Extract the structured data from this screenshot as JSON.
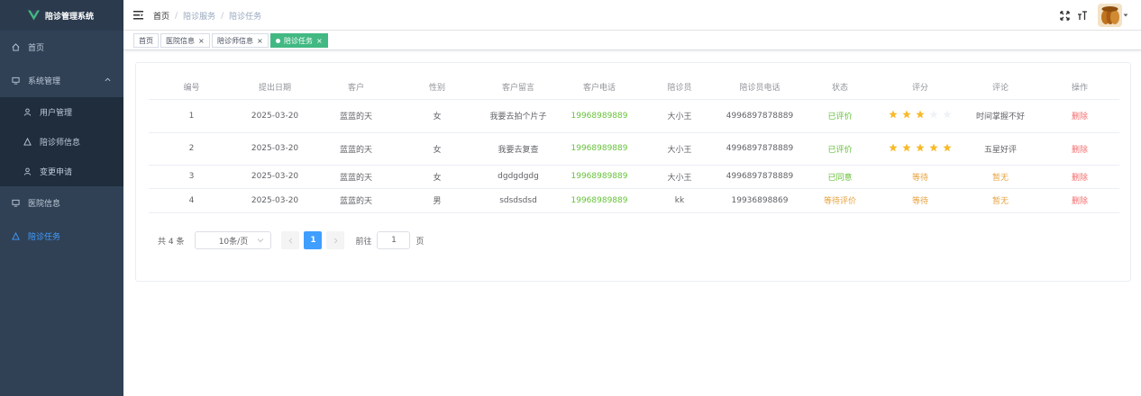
{
  "app": {
    "title": "陪诊管理系统",
    "brand_color": "#42b983"
  },
  "sidebar": {
    "items": [
      {
        "label": "首页",
        "icon": "home-icon"
      },
      {
        "label": "系统管理",
        "icon": "monitor-icon",
        "expanded": true,
        "children": [
          {
            "label": "用户管理",
            "icon": "user-icon"
          },
          {
            "label": "陪诊师信息",
            "icon": "peoples-icon"
          },
          {
            "label": "变更申请",
            "icon": "user-icon"
          }
        ]
      },
      {
        "label": "医院信息",
        "icon": "monitor-icon"
      },
      {
        "label": "陪诊任务",
        "icon": "peoples-icon",
        "active": true
      }
    ]
  },
  "navbar": {
    "breadcrumb": [
      "首页",
      "陪诊服务",
      "陪诊任务"
    ]
  },
  "tags": [
    {
      "label": "首页",
      "closable": false
    },
    {
      "label": "医院信息",
      "closable": true
    },
    {
      "label": "陪诊师信息",
      "closable": true
    },
    {
      "label": "陪诊任务",
      "closable": true,
      "active": true
    }
  ],
  "table": {
    "columns": [
      "编号",
      "提出日期",
      "客户",
      "性别",
      "客户留言",
      "客户电话",
      "陪诊员",
      "陪诊员电话",
      "状态",
      "评分",
      "评论",
      "操作"
    ],
    "rows": [
      {
        "id": "1",
        "date": "2025-03-20",
        "customer": "蓝蓝的天",
        "gender": "女",
        "message": "我要去拍个片子",
        "phone": "19968989889",
        "escort": "大小王",
        "escort_phone": "4996897878889",
        "status": "已评价",
        "rating": 3,
        "comment": "时间掌握不好",
        "action": "删除"
      },
      {
        "id": "2",
        "date": "2025-03-20",
        "customer": "蓝蓝的天",
        "gender": "女",
        "message": "我要去复查",
        "phone": "19968989889",
        "escort": "大小王",
        "escort_phone": "4996897878889",
        "status": "已评价",
        "rating": 5,
        "comment": "五星好评",
        "action": "删除"
      },
      {
        "id": "3",
        "date": "2025-03-20",
        "customer": "蓝蓝的天",
        "gender": "女",
        "message": "dgdgdgdg",
        "phone": "19968989889",
        "escort": "大小王",
        "escort_phone": "4996897878889",
        "status": "已同意",
        "rating_text": "等待",
        "comment": "暂无",
        "action": "删除"
      },
      {
        "id": "4",
        "date": "2025-03-20",
        "customer": "蓝蓝的天",
        "gender": "男",
        "message": "sdsdsdsd",
        "phone": "19968989889",
        "escort": "kk",
        "escort_phone": "19936898869",
        "status": "等待评价",
        "rating_text": "等待",
        "comment": "暂无",
        "action": "删除"
      }
    ]
  },
  "pagination": {
    "total_text": "共 4 条",
    "page_size": "10条/页",
    "current_page": "1",
    "goto_label": "前往",
    "goto_value": "1",
    "page_suffix": "页"
  },
  "colors": {
    "primary": "#409eff",
    "success": "#67c23a",
    "warning": "#e6a23c",
    "danger": "#f56c6c",
    "sidebar_bg": "#304156"
  }
}
